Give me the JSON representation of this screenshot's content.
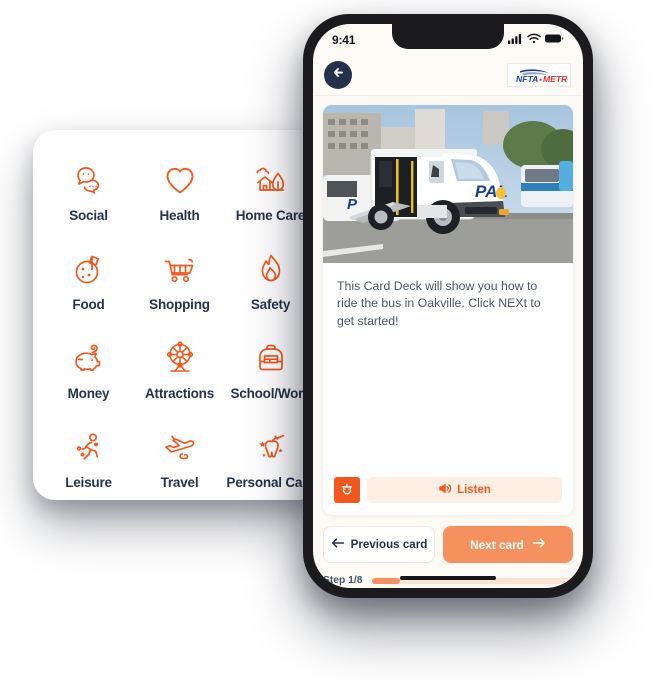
{
  "categories": [
    {
      "label": "Social",
      "icon": "speech-bubbles-icon"
    },
    {
      "label": "Health",
      "icon": "heart-icon"
    },
    {
      "label": "Home Care",
      "icon": "house-tree-icon"
    },
    {
      "label": "Food",
      "icon": "pizza-icon"
    },
    {
      "label": "Shopping",
      "icon": "shopping-cart-icon"
    },
    {
      "label": "Safety",
      "icon": "flame-icon"
    },
    {
      "label": "Money",
      "icon": "piggy-bank-icon"
    },
    {
      "label": "Attractions",
      "icon": "ferris-wheel-icon"
    },
    {
      "label": "School/Work",
      "icon": "backpack-icon"
    },
    {
      "label": "Leisure",
      "icon": "running-person-icon"
    },
    {
      "label": "Travel",
      "icon": "airplane-icon"
    },
    {
      "label": "Personal Care",
      "icon": "tooth-brush-icon"
    }
  ],
  "phone": {
    "status_bar": {
      "time": "9:41",
      "signal_icon": "cellular-signal-icon",
      "wifi_icon": "wifi-icon",
      "battery_icon": "battery-icon"
    },
    "header": {
      "back_icon": "arrow-left-icon",
      "brand": "NFTA-METRO",
      "brand_nfta": "NFTA",
      "brand_metro": "METRO"
    },
    "card": {
      "image_alt": "white paratransit bus with wheelchair ramp deployed",
      "body_text": "This Card Deck will show you how to ride the bus in Oakville. Click NEXt to get started!",
      "accessibility_icon": "accessibility-smiley-icon",
      "listen_label": "Listen",
      "listen_icon": "speaker-icon"
    },
    "nav": {
      "previous_label": "Previous card",
      "previous_icon": "arrow-left-icon",
      "next_label": "Next card",
      "next_icon": "arrow-right-icon"
    },
    "progress": {
      "step_label": "Step 1/8",
      "percent": 14
    },
    "home_indicator": "home-indicator-bar"
  },
  "colors": {
    "icon_orange": "#f2581e",
    "accent_orange": "#f5915f",
    "label_navy": "#26334d",
    "screen_bg": "#fdfaf6",
    "progress_track": "#fbe3d2",
    "listen_bg": "#fdeee4"
  }
}
